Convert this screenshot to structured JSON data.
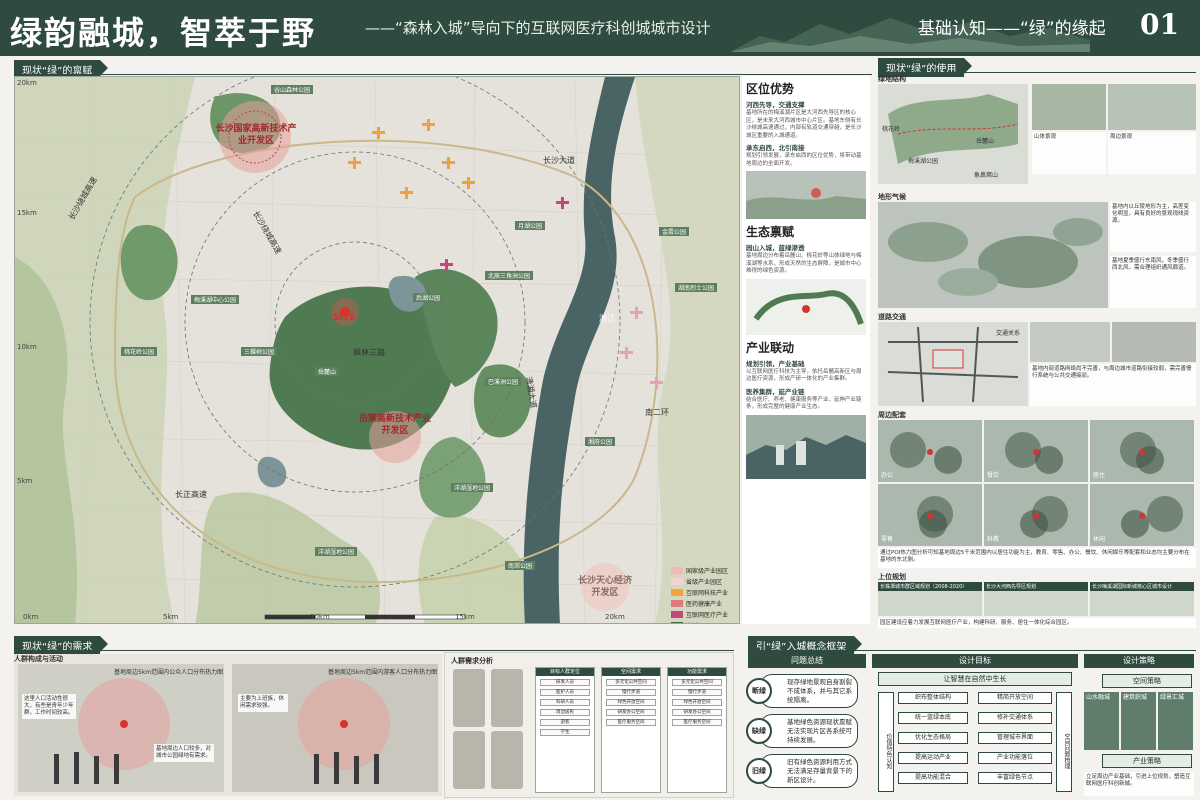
{
  "header": {
    "title": "绿韵融城，智萃于野",
    "subtitle": "——“森林入城”导向下的互联网医疗科创城城市设计",
    "section": "基础认知——“绿”的缘起",
    "page_num": "01"
  },
  "tabs": {
    "map": "现状“绿”的禀赋",
    "use": "现状“绿”的使用",
    "demand": "现状“绿”的需求",
    "concept": "引“绿”入城概念框架"
  },
  "map": {
    "scale_labels": {
      "top_left": "20km",
      "y15": "15km",
      "y10": "10km",
      "y5": "5km",
      "bot_left": "0km",
      "x5": "5km",
      "x10": "10km",
      "x15": "15km",
      "x20": "20km"
    },
    "zones": {
      "north": "长沙国家高新技术产业开发区",
      "mid": "岳麓高新技术产业开发区",
      "south": "长沙天心经济开发区"
    },
    "site_label": "SITE",
    "roads": [
      "长沙绕城高速",
      "长沙绕城高速",
      "长沙大道",
      "枫林三路",
      "潇湘大道",
      "湘江",
      "长正高速",
      "南二环"
    ],
    "parks": [
      "梅溪湖中心公园",
      "洋湖湿地公园",
      "巴溪洲公园",
      "北辰三角洲公园",
      "谷山森林公园",
      "桃花岭公园",
      "后湖公园",
      "金霞公园",
      "湖南烈士公园",
      "月湖公园",
      "岳麓山",
      "南郊公园",
      "三棵树公园",
      "洋湖湿地公园",
      "湘府公园"
    ],
    "legend": [
      "国家级产业园区",
      "省级产业园区",
      "互联网科技产业",
      "医药健康产业",
      "互联网医疗产业",
      "森林公园",
      "公园",
      "耕地保留",
      "灌木丛",
      "林地",
      "湖泊",
      "城区边界"
    ],
    "legend_colors": [
      "#f2b8b4",
      "#f5d2cf",
      "#f5a33a",
      "#e07a7a",
      "#c2487a",
      "#3f6b47",
      "#7fa77f",
      "#bfcf98",
      "#d8dcb0",
      "#a9c08f",
      "#8fa6a8",
      "#777777"
    ]
  },
  "text_panel": {
    "sec1_title": "区位优势",
    "sec1_sub1": "河西先导，交通支撑",
    "sec1_body1": "基地所在的梅溪湖片区是大河西先导区的核心区，是未来大河西城市中心片区。基地东侧有长沙绕城高速通过，内部有轨道交通穿越，是长沙城区重要的入城通道。",
    "sec1_sub2": "承东启西，北引南接",
    "sec1_body2": "规划引领发展，承东启西的区位优势，将带动基地周边的全面开发。",
    "sec2_title": "生态禀赋",
    "sec2_sub": "园山入城，蓝绿渗透",
    "sec2_body": "基地周边分布着岳麓山、桃花岭等山体绿地与梅溪湖等水系，形成天然的生态屏障，是城市中心难得的绿色资源。",
    "sec3_title": "产业联动",
    "sec3_sub": "规划引领，产业基础",
    "sec3_body": "以互联网医疗科技为主导，依托岳麓高新区与周边医疗资源，形成产研一体化的产业集群。",
    "sec3_sub2": "医养集群，延产业链",
    "sec3_body2": "结合医疗、养老、健康服务等产业，延伸产业链条，形成完整的健康产业生态。"
  },
  "use_panel": {
    "s1": "绿地结构",
    "s1_labels": [
      "桃花岭",
      "梅溪湖公园",
      "岳麓山",
      "象鼻窝山",
      "山体景观",
      "周边景观"
    ],
    "s2": "地形气候",
    "s2_notes": [
      "基地内以丘陵地形为主，高差变化明显，具有良好的景观视线资源。",
      "基地夏季盛行东南风，冬季盛行西北风，需合理组织通风廊道。"
    ],
    "s3": "道路交通",
    "s3_label": "交通关系",
    "s3_note": "基地内部道路网络尚不完善，与周边城市道路衔接较弱，需完善慢行系统与公共交通接驳。",
    "s4": "周边配套",
    "heat_labels": [
      "办公",
      "餐饮",
      "居住",
      "零售",
      "科教",
      "休闲"
    ],
    "heat_note": "通过POI热力图分析可知基地周边5千米范围内以居住功能为主，教育、零售、办公、餐饮、休闲娱乐等配套和业态均主要分布在基地的东北侧。",
    "s5": "上位规划",
    "plan_hds": [
      "长株潭城市群区域规划（2008-2020）",
      "长沙大河西先导区规划",
      "长沙梅溪湖国际新城核心区城市设计"
    ],
    "plan_note": "园区建设应着力发展互联网医疗产业，构建科研、服务、居住一体化综合园区。"
  },
  "demand": {
    "s1": "人群构成与活动",
    "heat1": "基地周边5km范围内公众人口分布热力图",
    "heat2": "基地周边5km范围内游客人口分布热力图",
    "note1": "这里人口活动性很大，有些是青年少年群，工作时间较高。",
    "note2": "基地周边人口较多，对城市公园绿地有需求。",
    "note3": "主要为上班族，休闲需求较强。",
    "people_title": "人群需求分析",
    "cols": [
      "目标人群定位",
      "空间需求",
      "功能需求"
    ],
    "rows": [
      "研发人员",
      "医护人员",
      "科研人员",
      "周边居民",
      "游客",
      "学生"
    ],
    "needs": [
      "多元化公共空间",
      "慢行步道",
      "绿色开放空间",
      "研发办公空间",
      "医疗服务空间"
    ]
  },
  "concept": {
    "h1": "问题总结",
    "h2": "设计目标",
    "h3": "设计策略",
    "issues": [
      {
        "key": "断绿",
        "text": "现存绿地景观自身割裂不成体系，并与其它系统隔离。"
      },
      {
        "key": "缺绿",
        "text": "基地绿色资源现状禀赋无法实现片区各系统可持续发展。"
      },
      {
        "key": "旧绿",
        "text": "旧有绿色资源利用方式无法满足存量背景下的新区设计。"
      }
    ],
    "goal_head": "让智慧在自然中生长",
    "goal_side": "价值特色认知",
    "goals_left": [
      "织布整体结构",
      "统一蓝绿本底",
      "优化生态格局",
      "提高运动产业",
      "提高功能混合"
    ],
    "goals_right": [
      "精简开放空间",
      "修补交通体系",
      "管理城市界面",
      "产业功能落位",
      "丰富绿色节点"
    ],
    "goal_right_side": "空间问题梳理",
    "strategies": [
      "空间策略",
      "产业策略"
    ],
    "strat_boxes": [
      "山水融城",
      "建筑织城",
      "绿景汇城"
    ],
    "strat_note": "立足周边产业基础，引进上位规划，塑造互联网医疗科创新城。"
  }
}
